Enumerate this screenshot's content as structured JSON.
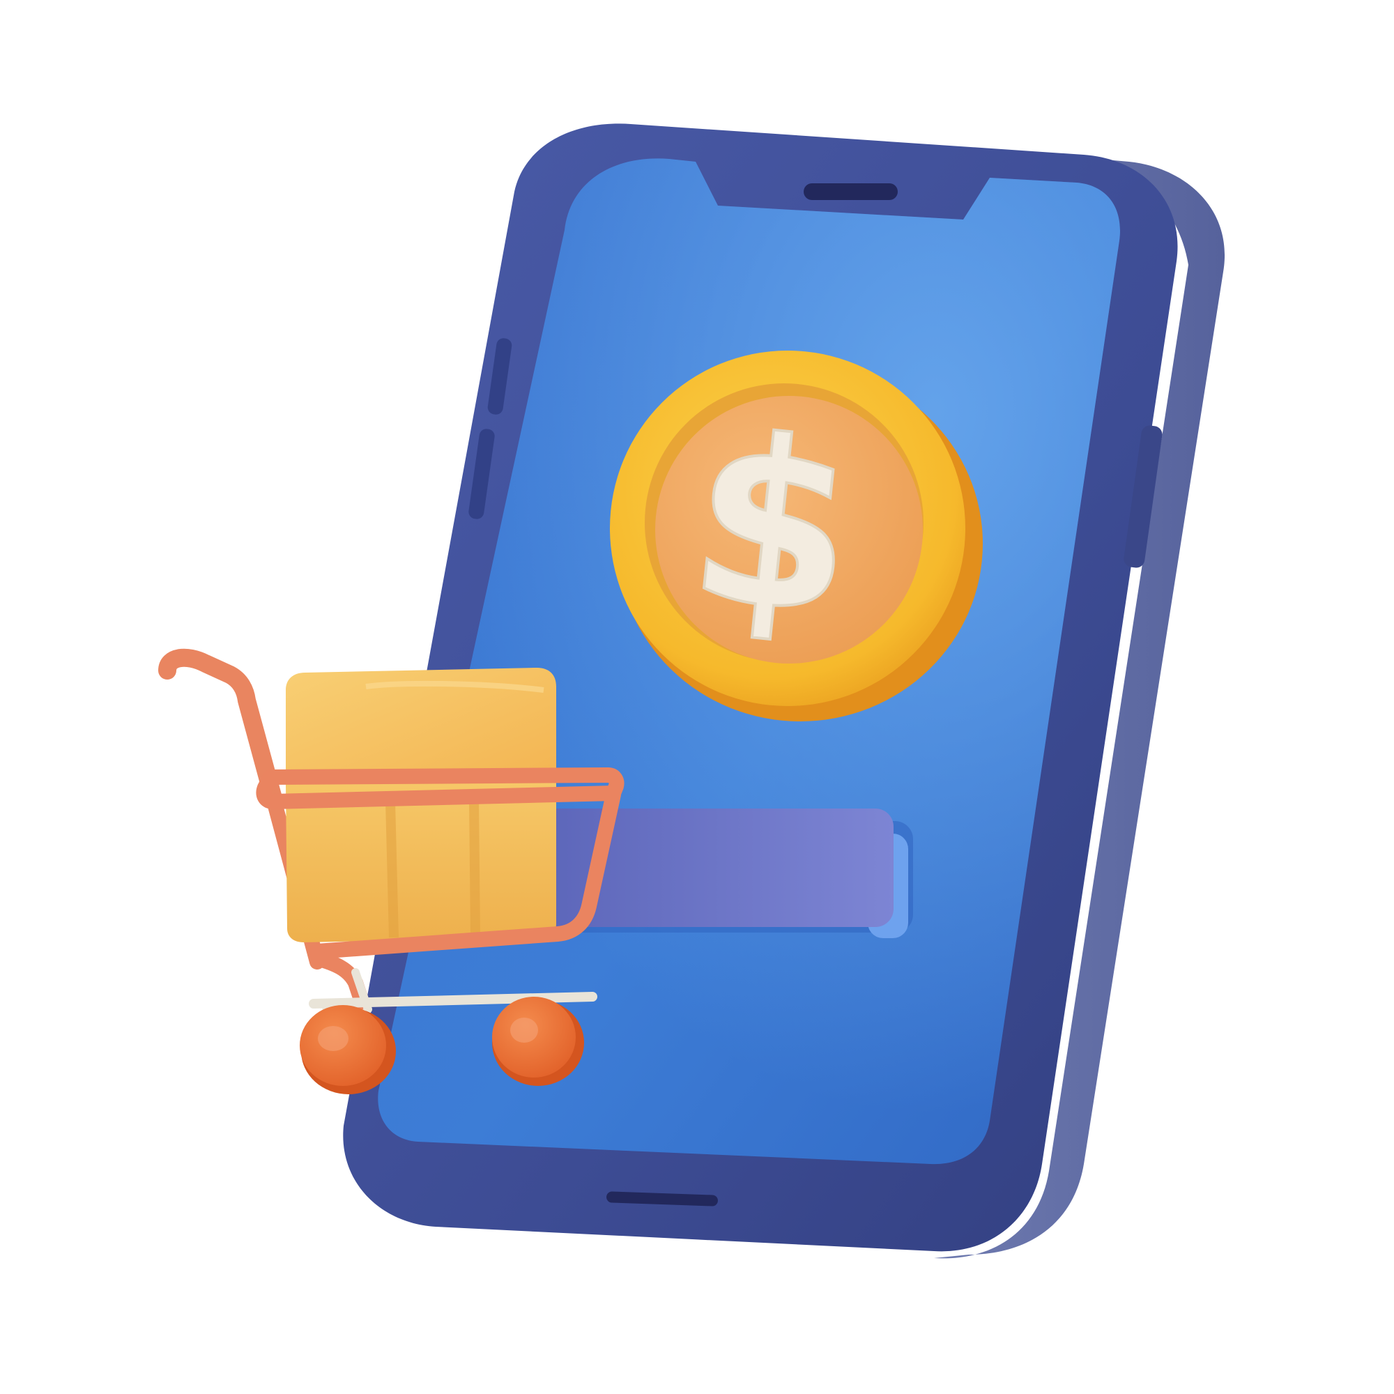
{
  "illustration": {
    "coin": {
      "symbol": "$"
    },
    "colors": {
      "phone_frame": "#3f4f9a",
      "phone_screen": "#3f7fd6",
      "screen_highlight": "#5c9be6",
      "coin_rim": "#f7bd2f",
      "coin_face": "#f1a85c",
      "coin_symbol": "#f5efe4",
      "cart_frame": "#ea8460",
      "cart_box": "#f6c25c",
      "cart_wheels": "#ec7638",
      "pay_bar": "#6c74c8"
    },
    "icons": [
      "smartphone-icon",
      "dollar-coin-icon",
      "shopping-cart-icon",
      "package-icon"
    ]
  }
}
